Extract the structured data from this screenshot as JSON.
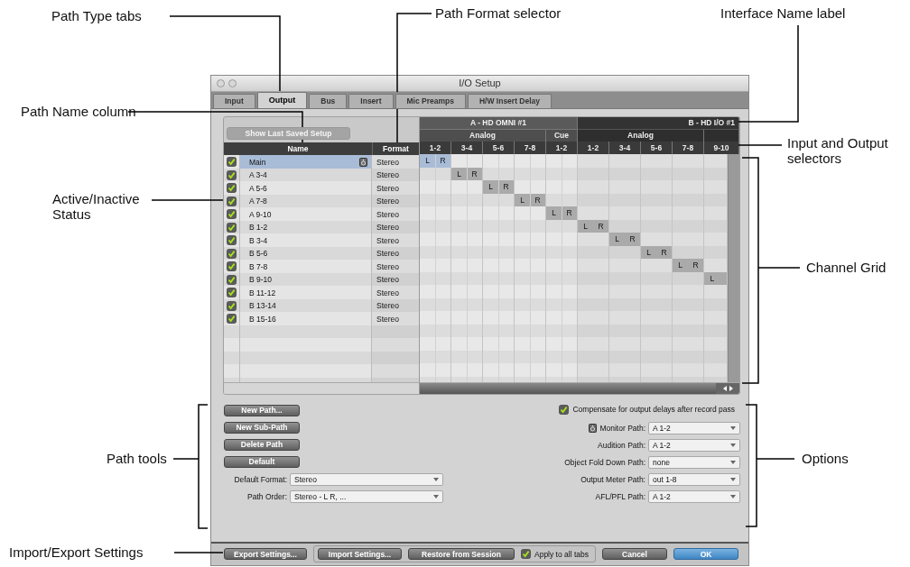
{
  "callouts": [
    {
      "text": "Path Type tabs"
    },
    {
      "text": "Path Format selector"
    },
    {
      "text": "Interface Name label"
    },
    {
      "text": "Path Name column"
    },
    {
      "text": "Active/Inactive Status"
    },
    {
      "text": "Input and Output selectors"
    },
    {
      "text": "Channel Grid"
    },
    {
      "text": "Path tools"
    },
    {
      "text": "Options"
    },
    {
      "text": "Import/Export Settings"
    }
  ],
  "window": {
    "title": "I/O Setup"
  },
  "tabs": [
    {
      "label": "Input",
      "selected": false
    },
    {
      "label": "Output",
      "selected": true
    },
    {
      "label": "Bus",
      "selected": false
    },
    {
      "label": "Insert",
      "selected": false
    },
    {
      "label": "Mic Preamps",
      "selected": false
    },
    {
      "label": "H/W Insert Delay",
      "selected": false
    }
  ],
  "show_last_saved_button": {
    "label": "Show Last Saved Setup",
    "disabled": true
  },
  "table": {
    "columns": [
      "Name",
      "Format"
    ]
  },
  "interfaces": [
    {
      "name": "A - HD OMNI #1",
      "groups": [
        {
          "name": "Analog",
          "channels": [
            "1-2",
            "3-4",
            "5-6",
            "7-8"
          ]
        },
        {
          "name": "Cue",
          "channels": [
            "1-2"
          ]
        }
      ]
    },
    {
      "name": "B - HD I/O #1",
      "groups": [
        {
          "name": "Analog",
          "channels": [
            "1-2",
            "3-4",
            "5-6",
            "7-8"
          ]
        },
        {
          "channels": [
            "9-10"
          ]
        }
      ]
    }
  ],
  "paths": [
    {
      "active": true,
      "name": "Main",
      "monitor": true,
      "selected": true,
      "format": "Stereo",
      "labels": [
        "L",
        "R"
      ],
      "assigned": [
        true,
        false,
        false,
        false,
        false,
        false,
        false,
        false,
        false,
        false
      ]
    },
    {
      "active": true,
      "name": "A 3-4",
      "monitor": false,
      "selected": false,
      "format": "Stereo",
      "labels": [
        "L",
        "R"
      ],
      "assigned": [
        false,
        true,
        false,
        false,
        false,
        false,
        false,
        false,
        false,
        false
      ]
    },
    {
      "active": true,
      "name": "A 5-6",
      "monitor": false,
      "selected": false,
      "format": "Stereo",
      "labels": [
        "L",
        "R"
      ],
      "assigned": [
        false,
        false,
        true,
        false,
        false,
        false,
        false,
        false,
        false,
        false
      ]
    },
    {
      "active": true,
      "name": "A 7-8",
      "monitor": false,
      "selected": false,
      "format": "Stereo",
      "labels": [
        "L",
        "R"
      ],
      "assigned": [
        false,
        false,
        false,
        true,
        false,
        false,
        false,
        false,
        false,
        false
      ]
    },
    {
      "active": true,
      "name": "A 9-10",
      "monitor": false,
      "selected": false,
      "format": "Stereo",
      "labels": [
        "L",
        "R"
      ],
      "assigned": [
        false,
        false,
        false,
        false,
        true,
        false,
        false,
        false,
        false,
        false
      ]
    },
    {
      "active": true,
      "name": "B 1-2",
      "monitor": false,
      "selected": false,
      "format": "Stereo",
      "labels": [
        "L",
        "R"
      ],
      "assigned": [
        false,
        false,
        false,
        false,
        false,
        true,
        false,
        false,
        false,
        false
      ]
    },
    {
      "active": true,
      "name": "B 3-4",
      "monitor": false,
      "selected": false,
      "format": "Stereo",
      "labels": [
        "L",
        "R"
      ],
      "assigned": [
        false,
        false,
        false,
        false,
        false,
        false,
        true,
        false,
        false,
        false
      ]
    },
    {
      "active": true,
      "name": "B 5-6",
      "monitor": false,
      "selected": false,
      "format": "Stereo",
      "labels": [
        "L",
        "R"
      ],
      "assigned": [
        false,
        false,
        false,
        false,
        false,
        false,
        false,
        true,
        false,
        false
      ]
    },
    {
      "active": true,
      "name": "B 7-8",
      "monitor": false,
      "selected": false,
      "format": "Stereo",
      "labels": [
        "L",
        "R"
      ],
      "assigned": [
        false,
        false,
        false,
        false,
        false,
        false,
        false,
        false,
        true,
        false
      ]
    },
    {
      "active": true,
      "name": "B 9-10",
      "monitor": false,
      "selected": false,
      "format": "Stereo",
      "labels": [
        "L"
      ],
      "assigned": [
        false,
        false,
        false,
        false,
        false,
        false,
        false,
        false,
        false,
        true
      ]
    },
    {
      "active": true,
      "name": "B 11-12",
      "monitor": false,
      "selected": false,
      "format": "Stereo",
      "assigned": [
        false,
        false,
        false,
        false,
        false,
        false,
        false,
        false,
        false,
        false
      ]
    },
    {
      "active": true,
      "name": "B 13-14",
      "monitor": false,
      "selected": false,
      "format": "Stereo",
      "assigned": [
        false,
        false,
        false,
        false,
        false,
        false,
        false,
        false,
        false,
        false
      ]
    },
    {
      "active": true,
      "name": "B 15-16",
      "monitor": false,
      "selected": false,
      "format": "Stereo",
      "assigned": [
        false,
        false,
        false,
        false,
        false,
        false,
        false,
        false,
        false,
        false
      ]
    }
  ],
  "path_tools": [
    "New Path...",
    "New Sub-Path",
    "Delete Path",
    "Default"
  ],
  "path_settings": [
    {
      "label": "Default Format:",
      "value": "Stereo"
    },
    {
      "label": "Path Order:",
      "value": "Stereo - L R, ..."
    }
  ],
  "compensate": {
    "label": "Compensate for output delays after record pass",
    "checked": true
  },
  "options": [
    {
      "label": "Monitor Path:",
      "value": "A 1-2",
      "icon": true
    },
    {
      "label": "Audition Path:",
      "value": "A 1-2",
      "icon": false
    },
    {
      "label": "Object Fold Down Path:",
      "value": "none",
      "icon": false
    },
    {
      "label": "Output Meter Path:",
      "value": "out 1-8",
      "icon": false
    },
    {
      "label": "AFL/PFL Path:",
      "value": "A 1-2",
      "icon": false
    }
  ],
  "footer": {
    "left_buttons": [
      "Export Settings..."
    ],
    "group_buttons": [
      "Import Settings...",
      "Restore from Session"
    ],
    "apply_all": {
      "label": "Apply to all tabs",
      "checked": true
    },
    "buttons": [
      {
        "label": "Cancel",
        "kind": "normal"
      },
      {
        "label": "OK",
        "kind": "default"
      }
    ]
  }
}
